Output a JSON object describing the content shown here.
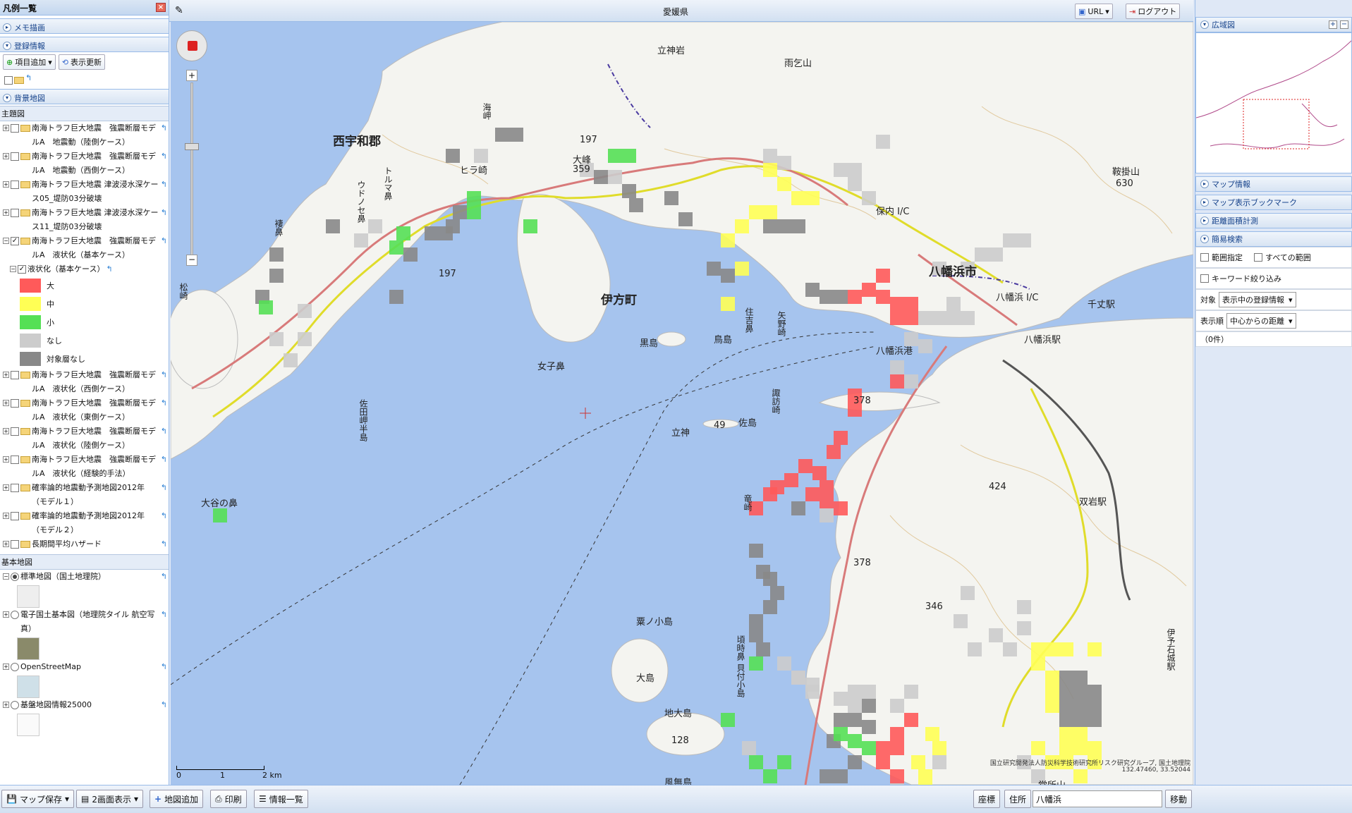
{
  "left": {
    "title": "凡例一覧",
    "sec_memo": "メモ描画",
    "sec_reg": "登録情報",
    "add_item": "項目追加",
    "refresh": "表示更新",
    "sec_bg": "背景地図",
    "theme_hdr": "主題図",
    "layers": [
      "南海トラフ巨大地震　強震断層モデルA　地震動（陸側ケース）",
      "南海トラフ巨大地震　強震断層モデルA　地震動（西側ケース）",
      "南海トラフ巨大地震 津波浸水深ケース05_堤防03分破壊",
      "南海トラフ巨大地震 津波浸水深ケース11_堤防03分破壊",
      "南海トラフ巨大地震　強震断層モデルA　液状化（基本ケース）"
    ],
    "sublayer": "液状化（基本ケース）",
    "legend": [
      {
        "label": "大",
        "color": "#ff5a5a"
      },
      {
        "label": "中",
        "color": "#ffff55"
      },
      {
        "label": "小",
        "color": "#55e055"
      },
      {
        "label": "なし",
        "color": "#cccccc"
      },
      {
        "label": "対象層なし",
        "color": "#888888"
      }
    ],
    "layers2": [
      "南海トラフ巨大地震　強震断層モデルA　液状化（西側ケース）",
      "南海トラフ巨大地震　強震断層モデルA　液状化（東側ケース）",
      "南海トラフ巨大地震　強震断層モデルA　液状化（陸側ケース）",
      "南海トラフ巨大地震　強震断層モデルA　液状化（経験的手法）",
      "確率論的地震動予測地図2012年（モデル１）",
      "確率論的地震動予測地図2012年（モデル２）",
      "長期間平均ハザード"
    ],
    "base_hdr": "基本地図",
    "bases": [
      "標準地図（国土地理院）",
      "電子国土基本図（地理院タイル 航空写真）",
      "OpenStreetMap",
      "基盤地図情報25000"
    ]
  },
  "header": {
    "title": "愛媛県",
    "url": "URL",
    "logout": "ログアウト"
  },
  "map": {
    "labels": {
      "nishiuwa": "西宇和郡",
      "ikata": "伊方町",
      "yawatahama": "八幡浜市",
      "tatsugami": "立神岩",
      "amagoiyama": "雨乞山",
      "hirasaki": "ヒラ崎",
      "omine": "大峰",
      "omine_h": "359",
      "kuroshima": "黒島",
      "torishima": "鳥島",
      "onagohana": "女子鼻",
      "sadamisaki": "佐田岬半島",
      "oshinohana": "大谷の鼻",
      "matsuzaki": "松崎",
      "tategami2": "立神",
      "sashima": "佐島",
      "sashima_h": "49",
      "kurumashima": "粟ノ小島",
      "oshima": "大島",
      "jidaishima": "地大島",
      "jidaishima_h": "128",
      "kaizukejima": "貝付小島",
      "kazenashijima": "風無島",
      "yawatahamaic": "八幡浜 I/C",
      "yawatahamaeki": "八幡浜駅",
      "senjoeki": "千丈駅",
      "futaiwaeki": "双岩駅",
      "yawatahamako": "八幡浜港",
      "toyohamaic": "保内 I/C",
      "yanozaki": "矢野崎",
      "suwazaki": "諏訪崎",
      "sumiyoshi": "住吉鼻",
      "kogeyama": "鞍掛山",
      "kogeyama_h": "630",
      "h424": "424",
      "h346": "346",
      "tatsuzaki": "竜崎",
      "kotozaki": "頃時鼻",
      "doshoyama": "堂所山",
      "umisaki": "海岬",
      "torumahana": "トルマ鼻",
      "udonose": "ウドノセ鼻",
      "manabana": "褄鼻",
      "iyoishi": "伊予石城駅",
      "r197": "197",
      "r378": "378",
      "scale0": "0",
      "scale1": "1",
      "scale2": "2 km",
      "attribution": "国立研究開発法人防災科学技術研究所リスク研究グループ, 国土地理院",
      "coords": "132.47460, 33.52044"
    }
  },
  "right": {
    "overview": "広域図",
    "mapinfo": "マップ情報",
    "bookmark": "マップ表示ブックマーク",
    "measure": "距離面積計測",
    "search": "簡易検索",
    "range": "範囲指定",
    "allrange": "すべての範囲",
    "keyword": "キーワード絞り込み",
    "target_lbl": "対象",
    "target_val": "表示中の登録情報",
    "order_lbl": "表示順",
    "order_val": "中心からの距離",
    "count": "（0件）"
  },
  "bottom": {
    "save": "マップ保存",
    "dual": "2画面表示",
    "addmap": "地図追加",
    "print": "印刷",
    "infolist": "情報一覧",
    "coord": "座標",
    "address": "住所",
    "search_val": "八幡浜",
    "move": "移動"
  },
  "colors": {
    "red": "#ff5a5a",
    "yellow": "#ffff55",
    "green": "#55e055",
    "lightgray": "#cccccc",
    "darkgray": "#888888",
    "sea": "#a6c4ee",
    "land": "#f4f4f0"
  }
}
